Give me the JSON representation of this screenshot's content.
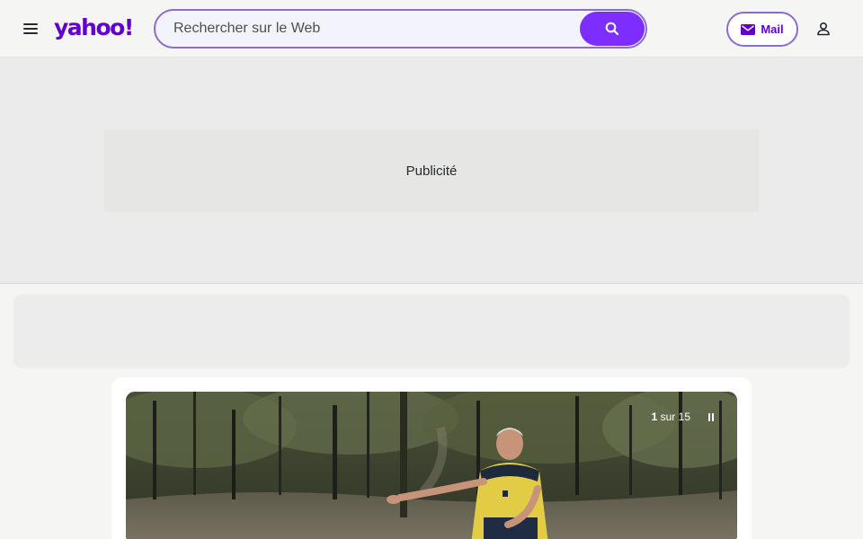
{
  "header": {
    "logo_text": "yahoo!",
    "search": {
      "placeholder": "Rechercher sur le Web",
      "value": ""
    },
    "mail_label": "Mail",
    "icons": {
      "menu": "hamburger-menu-icon",
      "search": "search-icon",
      "mail": "envelope-icon",
      "profile": "user-profile-icon"
    }
  },
  "ad": {
    "label": "Publicité"
  },
  "slideshow": {
    "current": "1",
    "separator": "sur",
    "total": "15",
    "pause_icon": "pause-icon",
    "image_alt": "man in yellow polo shirt gesturing in burnt forest"
  },
  "colors": {
    "brand": "#6001d2",
    "accent": "#7d2eff",
    "background": "#f5f5f4"
  }
}
